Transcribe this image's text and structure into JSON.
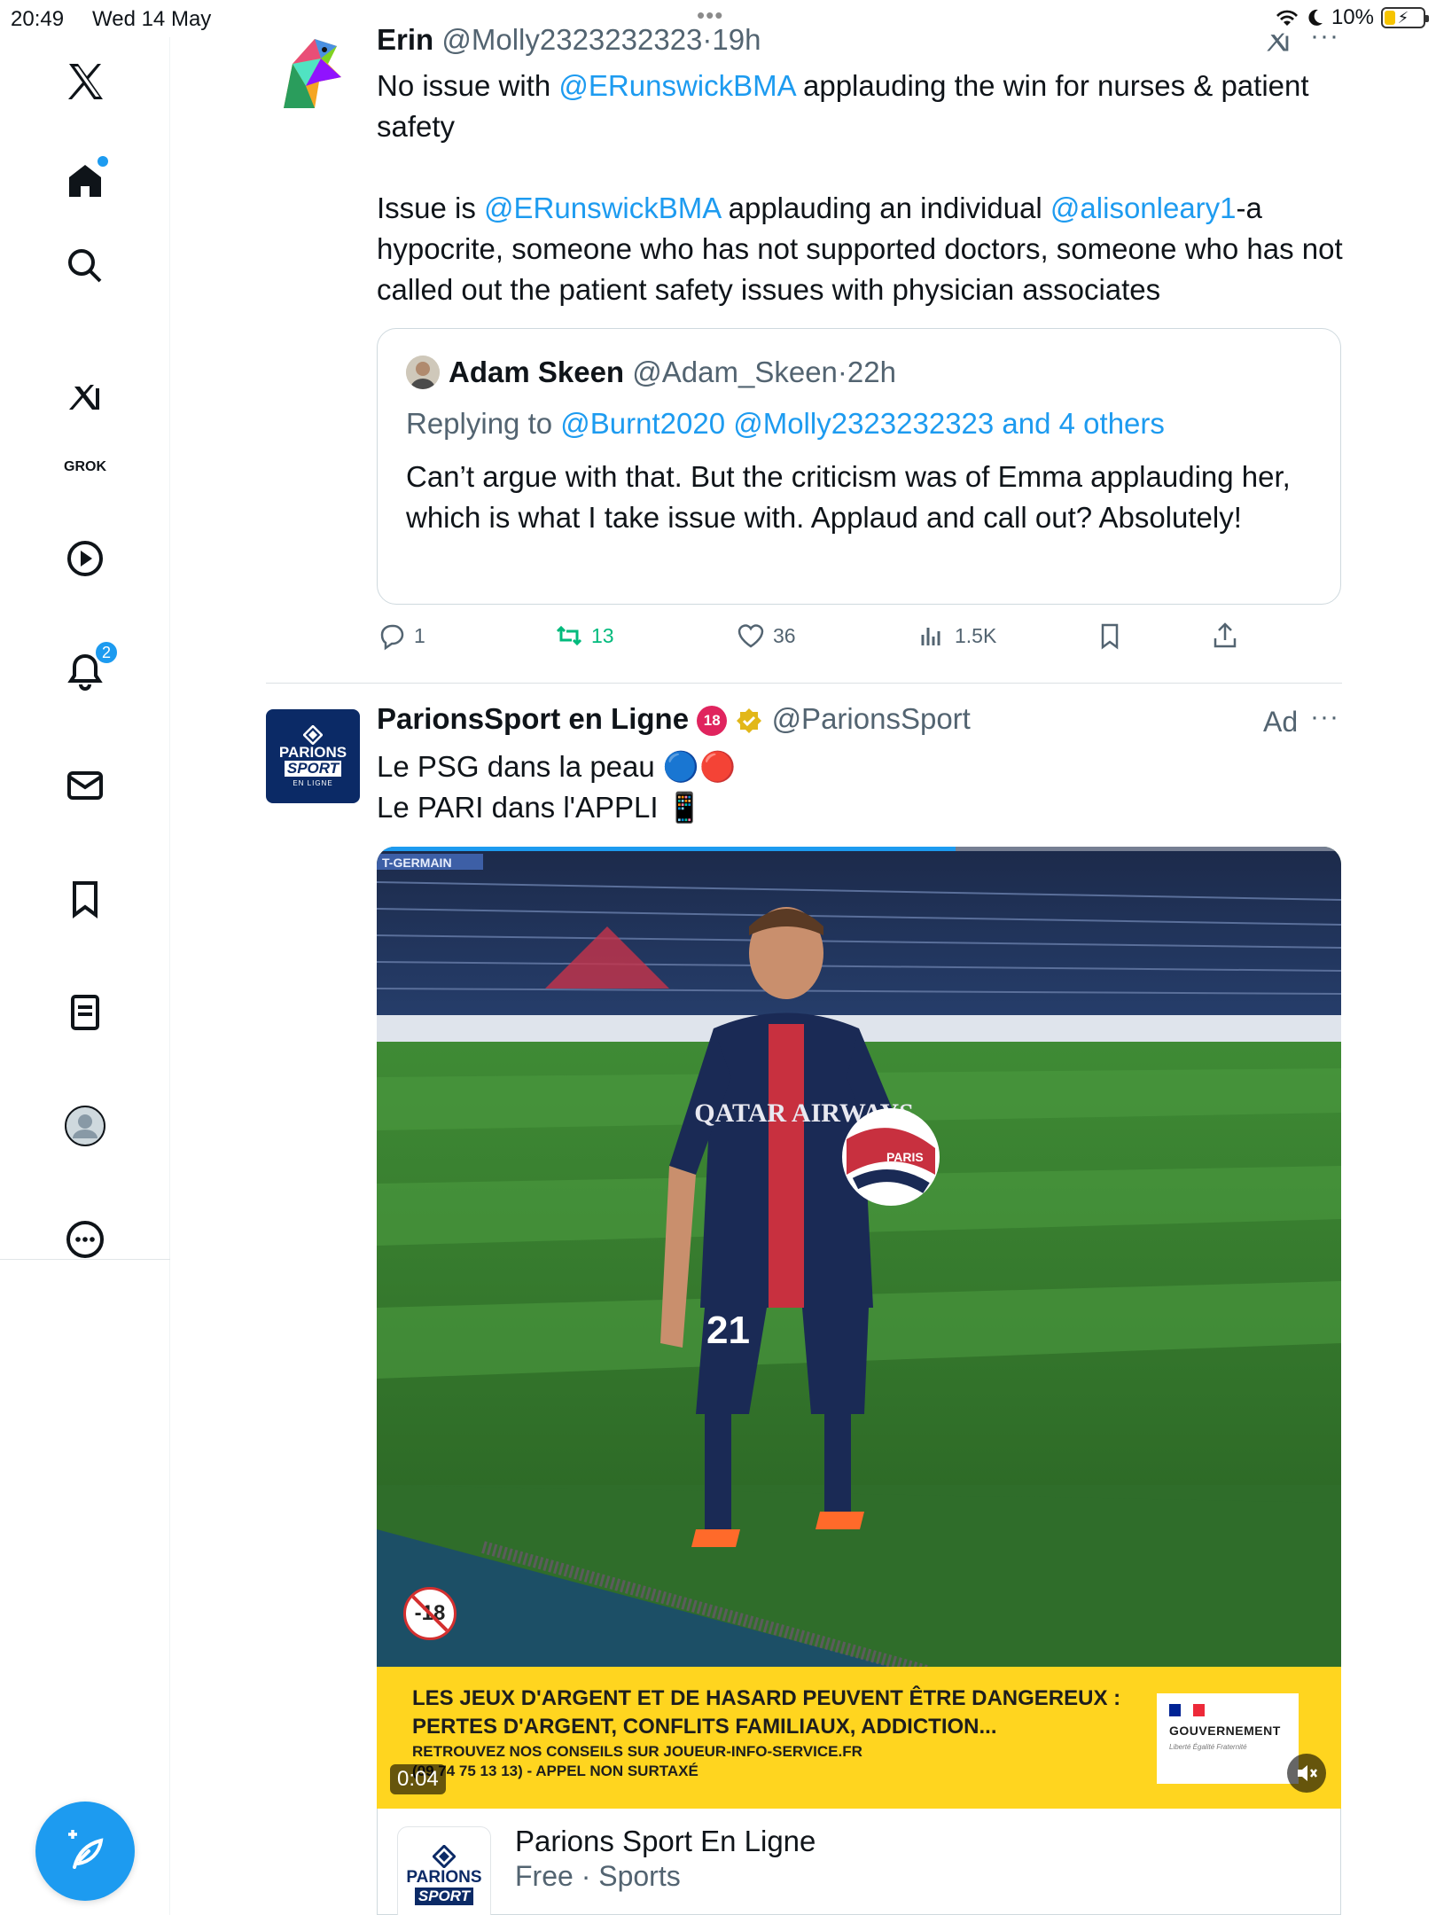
{
  "status_bar": {
    "time": "20:49",
    "date": "Wed 14 May",
    "battery": "10%",
    "top_dots": "•••"
  },
  "sidebar": {
    "grok_label": "GROK",
    "notifications_count": "2",
    "items": [
      "x-logo",
      "home",
      "explore",
      "grok",
      "video",
      "notifications",
      "messages",
      "bookmarks",
      "lists",
      "profile",
      "more"
    ]
  },
  "tweet1": {
    "name": "Erin",
    "handle": "@Molly2323232323",
    "sep": "·",
    "time": "19h",
    "p1_a": "No issue with ",
    "p1_mention": "@ERunswickBMA",
    "p1_b": " applauding the win for nurses & patient safety",
    "p2_a": "Issue is ",
    "p2_mention1": "@ERunswickBMA",
    "p2_b": " applauding an individual ",
    "p2_mention2": "@alisonleary1",
    "p2_c": "-a hypocrite, someone who has not supported doctors, someone who has not called out the patient safety issues with physician associates",
    "more": "···",
    "quote": {
      "name": "Adam Skeen",
      "handle": "@Adam_Skeen",
      "sep": "·",
      "time": "22h",
      "replying_label": "Replying to ",
      "replying_to": "@Burnt2020 @Molly2323232323 and 4 others",
      "text": "Can’t argue with that. But the criticism was of Emma applauding her, which is what I take issue with. Applaud and call out? Absolutely!"
    },
    "actions": {
      "replies": "1",
      "reposts": "13",
      "likes": "36",
      "views": "1.5K"
    }
  },
  "tweet2": {
    "name": "ParionsSport en Ligne",
    "handle": "@ParionsSport",
    "ad_label": "Ad",
    "more": "···",
    "line1": "Le PSG dans la peau 🔵🔴",
    "line2": "Le PARI dans l'APPLI 📱",
    "logo": {
      "l1": "PARIONS",
      "l2": "SPORT",
      "l3": "EN LIGNE"
    },
    "video": {
      "age_badge": "-18",
      "warning_line1": "LES JEUX D'ARGENT ET DE HASARD PEUVENT ÊTRE DANGEREUX :",
      "warning_line2": "PERTES D'ARGENT, CONFLITS FAMILIAUX, ADDICTION...",
      "warning_line3": "RETROUVEZ NOS CONSEILS SUR JOUEUR-INFO-SERVICE.FR",
      "warning_line4": "(09 74 75 13 13) - APPEL NON SURTAXÉ",
      "gov_label": "GOUVERNEMENT",
      "gov_motto": "Liberté Égalité Fraternité",
      "timestamp": "0:04",
      "progress": 0.6,
      "jersey_number": "21",
      "jersey_sponsor": "QATAR AIRWAYS",
      "ball_text": "PARIS",
      "stand_text": "T-GERMAIN"
    },
    "app_card": {
      "icon_l1": "PARIONS",
      "icon_l2": "SPORT",
      "title": "Parions Sport En Ligne",
      "subtitle": "Free · Sports"
    }
  },
  "colors": {
    "accent": "#1d9bf0",
    "repost_green": "#00ba7c",
    "text_secondary": "#536471",
    "warning_yellow": "#ffd51f",
    "ps_navy": "#0b2a66"
  }
}
